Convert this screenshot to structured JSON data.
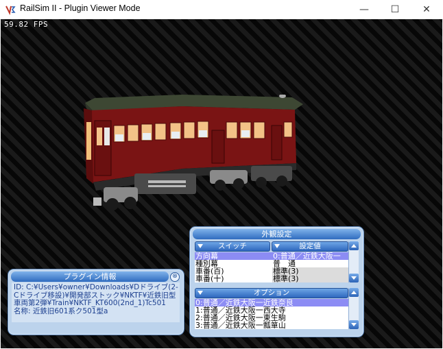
{
  "window": {
    "title": "RailSim II - Plugin Viewer Mode",
    "controls": {
      "minimize": "—",
      "maximize": "☐",
      "close": "✕"
    }
  },
  "viewport": {
    "fps": "59.82 FPS"
  },
  "appearance_panel": {
    "title": "外観設定",
    "switch_header": "スイッチ",
    "value_header": "設定値",
    "switch_rows": [
      {
        "name": "方向幕",
        "value": "0:普通／近鉄大阪一"
      },
      {
        "name": "種別幕",
        "value": "普　通"
      },
      {
        "name": "車番(百)",
        "value": "標準(3)"
      },
      {
        "name": "車番(十)",
        "value": "標準(3)"
      }
    ],
    "option_header": "オプション",
    "option_rows": [
      "0:普通／近鉄大阪一近鉄奈良",
      "1:普通／近鉄大阪一西大寺",
      "2:普通／近鉄大阪一東生駒",
      "3:普通／近鉄大阪一瓢箪山"
    ]
  },
  "plugin_panel": {
    "title": "プラグイン情報",
    "close_icon": "⊗",
    "id_text": "ID: C:¥Users¥owner¥Downloads¥Dドライブ(2-Cドライブ移設)¥開発部ストック¥NKTF¥近鉄旧型車両第2弾¥Train¥NKTF_KT600(2nd_1)Tc501",
    "name_text": "名称: 近鉄旧601系ク501型a"
  },
  "colors": {
    "panel_bg": "#bcd3ec",
    "selection": "#8c8cf4",
    "train_body": "#7a1414"
  }
}
